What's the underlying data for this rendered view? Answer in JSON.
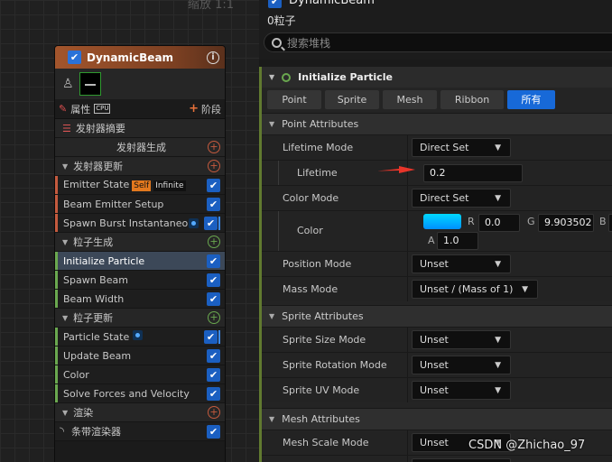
{
  "graph": {
    "zoom_label": "缩放 1:1",
    "node": {
      "title": "DynamicBeam",
      "info_icon": "info-icon",
      "attributes_label": "属性",
      "cpu_badge": "CPU",
      "stage_label": "阶段",
      "summary_label": "发射器摘要",
      "emitter_spawn_label": "发射器生成",
      "emitter_update_label": "发射器更新",
      "particle_spawn_label": "粒子生成",
      "particle_update_label": "粒子更新",
      "render_label": "渲染",
      "emitter_update_modules": [
        {
          "label": "Emitter State",
          "tag_self": "Self",
          "tag_infinite": "Infinite"
        },
        {
          "label": "Beam Emitter Setup"
        },
        {
          "label": "Spawn Burst Instantaneous"
        }
      ],
      "particle_spawn_modules": [
        {
          "label": "Initialize Particle",
          "selected": true
        },
        {
          "label": "Spawn Beam"
        },
        {
          "label": "Beam Width"
        }
      ],
      "particle_update_modules": [
        {
          "label": "Particle State"
        },
        {
          "label": "Update Beam"
        },
        {
          "label": "Color"
        },
        {
          "label": "Solve Forces and Velocity"
        }
      ],
      "renderer": {
        "label": "条带渲染器"
      }
    }
  },
  "details": {
    "emitter_name": "DynamicBeam",
    "particle_count": "0粒子",
    "search_placeholder": "搜索堆栈",
    "module_title": "Initialize Particle",
    "filters": [
      "Point",
      "Sprite",
      "Mesh",
      "Ribbon",
      "所有"
    ],
    "active_filter": "所有",
    "point_section": "Point Attributes",
    "lifetime_mode_label": "Lifetime Mode",
    "lifetime_mode_value": "Direct Set",
    "lifetime_label": "Lifetime",
    "lifetime_value": "0.2",
    "color_mode_label": "Color Mode",
    "color_mode_value": "Direct Set",
    "color_label": "Color",
    "color_r_label": "R",
    "color_r": "0.0",
    "color_g_label": "G",
    "color_g": "9.903502",
    "color_b_label": "B",
    "color_a_label": "A",
    "color_a": "1.0",
    "position_mode_label": "Position Mode",
    "position_mode_value": "Unset",
    "mass_mode_label": "Mass Mode",
    "mass_mode_value": "Unset / (Mass of 1)",
    "sprite_section": "Sprite Attributes",
    "sprite_size_label": "Sprite Size Mode",
    "sprite_size_value": "Unset",
    "sprite_rotation_label": "Sprite Rotation Mode",
    "sprite_rotation_value": "Unset",
    "sprite_uv_label": "Sprite UV Mode",
    "sprite_uv_value": "Unset",
    "mesh_section": "Mesh Attributes",
    "mesh_scale_label": "Mesh Scale Mode",
    "mesh_scale_value": "Unset",
    "watermark": "CSDN @Zhichao_97"
  },
  "colors": {
    "accent": "#1769d8",
    "node_header": "#a2552c",
    "swatch": "#00c8ff",
    "arrow": "#e8352a",
    "module_accent": "#617a30"
  }
}
